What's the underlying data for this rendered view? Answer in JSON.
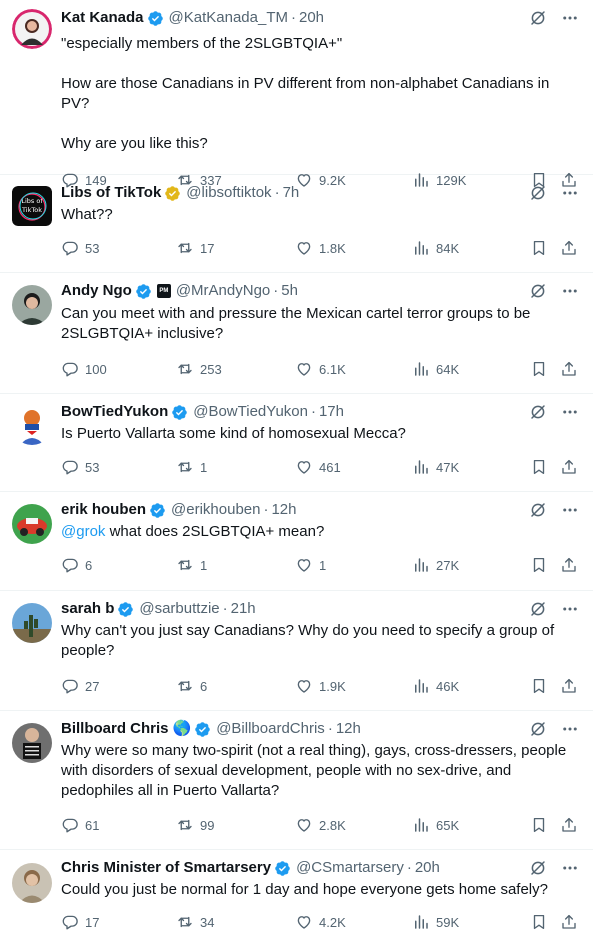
{
  "colors": {
    "text": "#0f1419",
    "secondary": "#536471",
    "accent": "#1d9bf0",
    "verified_gold": "#e2b719",
    "divider": "#eff3f4"
  },
  "icons": {
    "header": [
      "grok-icon",
      "more-icon"
    ],
    "actions": [
      "reply-icon",
      "retweet-icon",
      "like-icon",
      "views-icon",
      "bookmark-icon",
      "share-icon"
    ]
  },
  "replies": [
    {
      "name": "Kat Kanada",
      "verified": "blue",
      "handle": "@KatKanada_TM",
      "time": "20h",
      "text": "\"especially members of the 2SLGBTQIA+\"\n\nHow are those Canadians in PV different from non-alphabet Canadians in PV?\n\nWhy are you like this?",
      "replies": "149",
      "reposts": "337",
      "likes": "9.2K",
      "views": "129K"
    },
    {
      "name": "Libs of TikTok",
      "verified": "gold",
      "handle": "@libsoftiktok",
      "time": "7h",
      "avatar_text": "Libs of TikTok",
      "text": "What??",
      "replies": "53",
      "reposts": "17",
      "likes": "1.8K",
      "views": "84K"
    },
    {
      "name": "Andy Ngo",
      "verified": "blue",
      "affiliate_badge": "PM",
      "handle": "@MrAndyNgo",
      "time": "5h",
      "text": "Can you meet with and pressure the Mexican cartel terror groups to be 2SLGBTQIA+ inclusive?",
      "replies": "100",
      "reposts": "253",
      "likes": "6.1K",
      "views": "64K"
    },
    {
      "name": "BowTiedYukon",
      "verified": "blue",
      "handle": "@BowTiedYukon",
      "time": "17h",
      "text": "Is Puerto Vallarta some kind of homosexual Mecca?",
      "replies": "53",
      "reposts": "1",
      "likes": "461",
      "views": "47K"
    },
    {
      "name": "erik houben",
      "verified": "blue",
      "handle": "@erikhouben",
      "time": "12h",
      "mention": "@grok",
      "text": " what does 2SLGBTQIA+ mean?",
      "replies": "6",
      "reposts": "1",
      "likes": "1",
      "views": "27K"
    },
    {
      "name": "sarah b",
      "verified": "blue",
      "handle": "@sarbuttzie",
      "time": "21h",
      "text": "Why can't you just say Canadians? Why do you need to specify a group of people?",
      "replies": "27",
      "reposts": "6",
      "likes": "1.9K",
      "views": "46K"
    },
    {
      "name": "Billboard Chris",
      "emoji": "🌎",
      "verified": "blue",
      "handle": "@BillboardChris",
      "time": "12h",
      "text": "Why were so many two-spirit (not a real thing), gays, cross-dressers, people with disorders of sexual development, people with no sex-drive, and pedophiles all in Puerto Vallarta?",
      "replies": "61",
      "reposts": "99",
      "likes": "2.8K",
      "views": "65K"
    },
    {
      "name": "Chris Minister of Smartarsery",
      "verified": "blue",
      "handle": "@CSmartarsery",
      "time": "20h",
      "text": "Could you just be normal for 1 day and hope everyone gets home safely?",
      "replies": "17",
      "reposts": "34",
      "likes": "4.2K",
      "views": "59K"
    }
  ]
}
